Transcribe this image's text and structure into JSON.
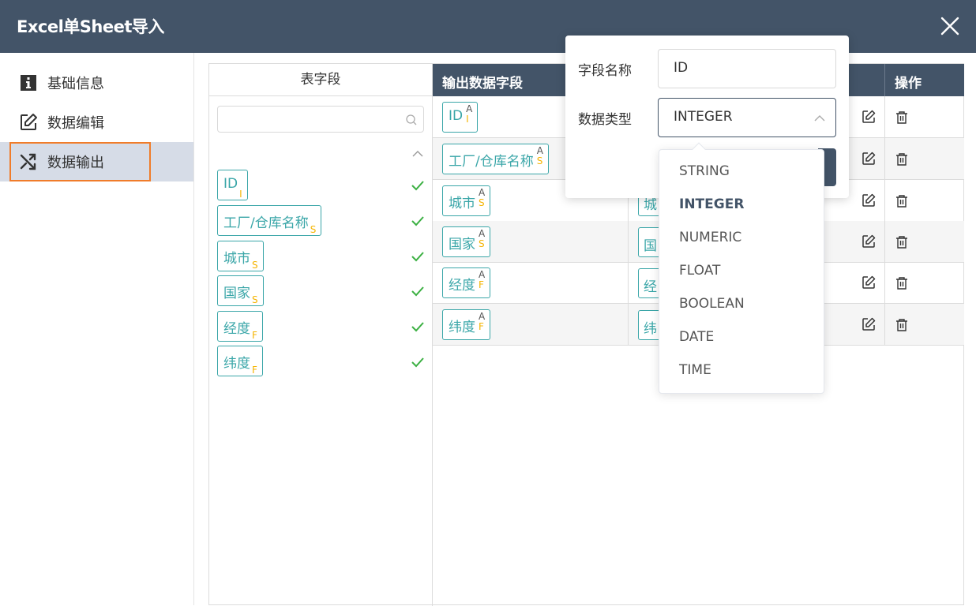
{
  "window": {
    "title": "Excel单Sheet导入"
  },
  "sidebar": {
    "items": [
      {
        "label": "基础信息",
        "icon": "info-icon"
      },
      {
        "label": "数据编辑",
        "icon": "edit-icon"
      },
      {
        "label": "数据输出",
        "icon": "shuffle-icon",
        "active": true
      }
    ]
  },
  "source": {
    "header": "表字段",
    "fields": [
      {
        "label": "ID",
        "type": "I"
      },
      {
        "label": "工厂/仓库名称",
        "type": "S"
      },
      {
        "label": "城市",
        "type": "S"
      },
      {
        "label": "国家",
        "type": "S"
      },
      {
        "label": "经度",
        "type": "F"
      },
      {
        "label": "纬度",
        "type": "F"
      }
    ]
  },
  "table": {
    "col_output": "输出数据字段",
    "col_action": "操作",
    "rows": [
      {
        "label": "ID",
        "a": "A",
        "type": "I",
        "out": ""
      },
      {
        "label": "工厂/仓库名称",
        "a": "A",
        "type": "S",
        "out": ""
      },
      {
        "label": "城市",
        "a": "A",
        "type": "S",
        "out": "城"
      },
      {
        "label": "国家",
        "a": "A",
        "type": "S",
        "out": "国"
      },
      {
        "label": "经度",
        "a": "A",
        "type": "F",
        "out": "经"
      },
      {
        "label": "纬度",
        "a": "A",
        "type": "F",
        "out": "纬"
      }
    ]
  },
  "popover": {
    "name_label": "字段名称",
    "name_value": "ID",
    "type_label": "数据类型",
    "type_value": "INTEGER"
  },
  "dropdown": {
    "options": [
      "STRING",
      "INTEGER",
      "NUMERIC",
      "FLOAT",
      "BOOLEAN",
      "DATE",
      "TIME"
    ],
    "selected": "INTEGER"
  },
  "colors": {
    "header": "#435468",
    "accent": "#3aa6a8",
    "type_badge": "#f5b400",
    "highlight": "#f07c2a",
    "check": "#3cb043"
  }
}
